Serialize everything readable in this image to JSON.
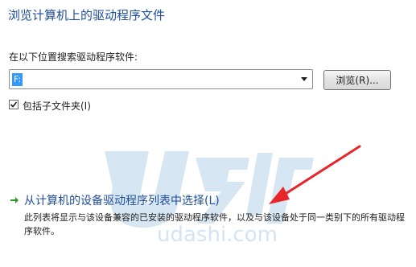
{
  "title": "浏览计算机上的驱动程序文件",
  "search": {
    "label": "在以下位置搜索驱动程序软件:",
    "value": "F:",
    "browse_label": "浏览(R)..."
  },
  "include_subfolders": {
    "label": "包括子文件夹(I)",
    "checked": true
  },
  "choose": {
    "label": "从计算机的设备驱动程序列表中选择(L)",
    "description": "此列表将显示与该设备兼容的已安装的驱动程序软件，以及与该设备处于同一类别下的所有驱动程序软件。"
  },
  "watermark": {
    "text": "udashi.com",
    "brand": "U大师"
  },
  "colors": {
    "link": "#1f4e99",
    "arrow": "#e8262a",
    "selection": "#3399ff"
  }
}
